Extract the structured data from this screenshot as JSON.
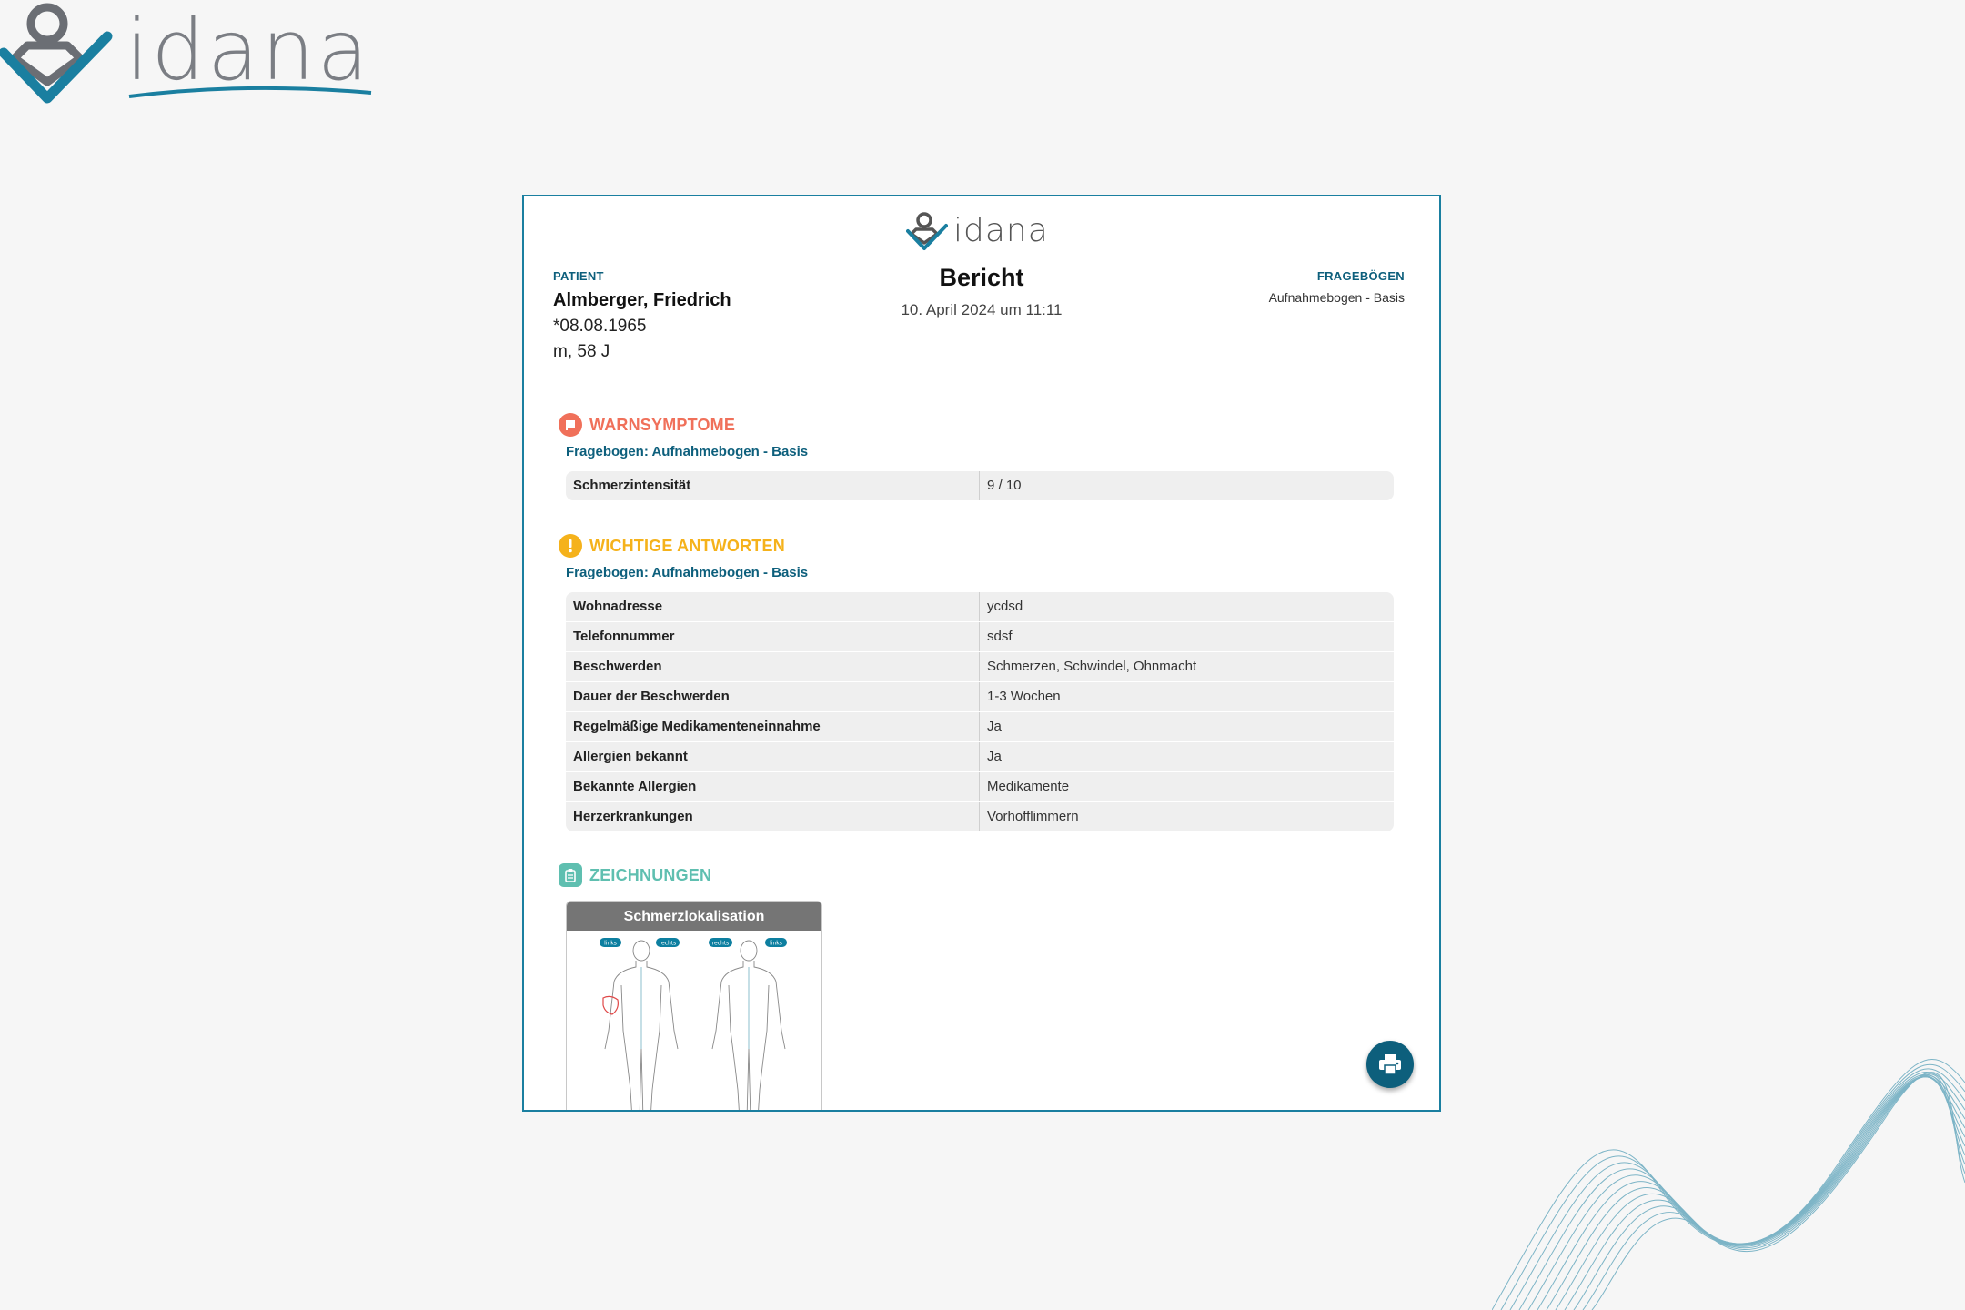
{
  "app": {
    "logo_text": "idana"
  },
  "report": {
    "logo_text": "idana",
    "title": "Bericht",
    "date": "10. April 2024 um 11:11",
    "patient": {
      "label": "PATIENT",
      "name": "Almberger, Friedrich",
      "birthdate": "*08.08.1965",
      "sex_age": "m, 58 J"
    },
    "forms": {
      "label": "FRAGEBÖGEN",
      "value": "Aufnahmebogen - Basis"
    },
    "sections": {
      "warn": {
        "title": "WARNSYMPTOME",
        "color": "#f0705a",
        "subtitle": "Fragebogen: Aufnahmebogen - Basis",
        "rows": [
          {
            "q": "Schmerzintensität",
            "a": "9 / 10"
          }
        ]
      },
      "important": {
        "title": "WICHTIGE ANTWORTEN",
        "color": "#f5b21b",
        "subtitle": "Fragebogen: Aufnahmebogen - Basis",
        "rows": [
          {
            "q": "Wohnadresse",
            "a": "ycdsd"
          },
          {
            "q": "Telefonnummer",
            "a": "sdsf"
          },
          {
            "q": "Beschwerden",
            "a": "Schmerzen, Schwindel, Ohnmacht"
          },
          {
            "q": "Dauer der Beschwerden",
            "a": "1-3 Wochen"
          },
          {
            "q": "Regelmäßige Medikamenteneinnahme",
            "a": "Ja"
          },
          {
            "q": "Allergien bekannt",
            "a": "Ja"
          },
          {
            "q": "Bekannte Allergien",
            "a": "Medikamente"
          },
          {
            "q": "Herzerkrankungen",
            "a": "Vorhofflimmern"
          }
        ]
      },
      "drawings": {
        "title": "ZEICHNUNGEN",
        "color": "#5fbfb0",
        "card_title": "Schmerzlokalisation",
        "badges": [
          "links",
          "rechts",
          "rechts",
          "links"
        ]
      }
    }
  },
  "colors": {
    "accent": "#0d5f7c",
    "frame": "#1a7fa0"
  },
  "icons": {
    "print": "printer-icon"
  }
}
